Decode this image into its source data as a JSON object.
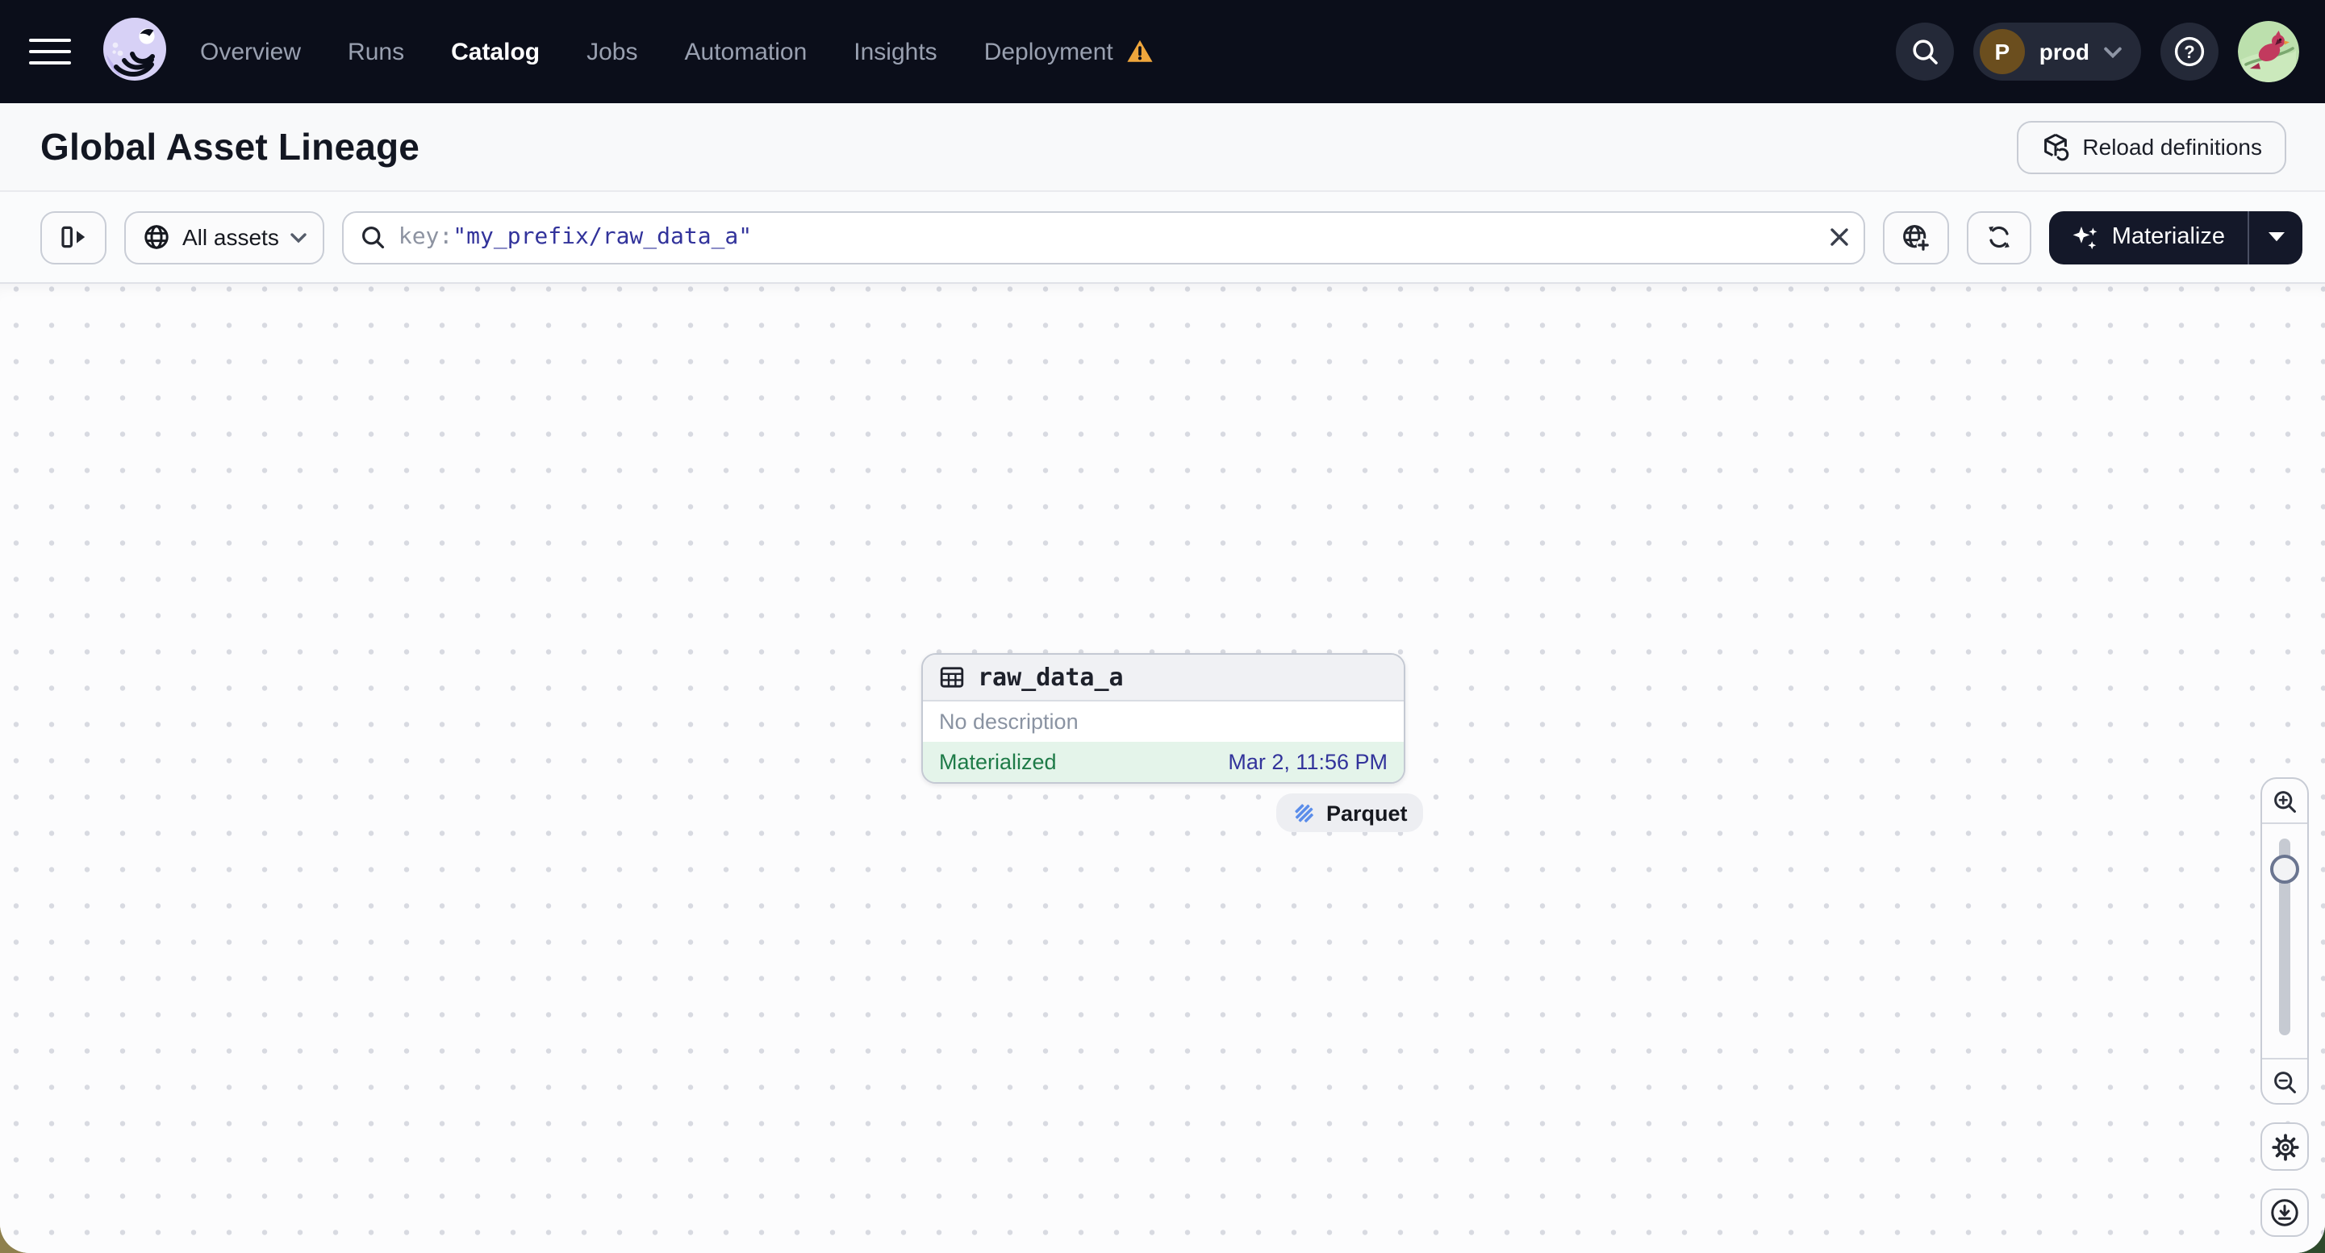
{
  "nav": {
    "items": [
      {
        "label": "Overview"
      },
      {
        "label": "Runs"
      },
      {
        "label": "Catalog"
      },
      {
        "label": "Jobs"
      },
      {
        "label": "Automation"
      },
      {
        "label": "Insights"
      },
      {
        "label": "Deployment"
      }
    ],
    "environment": {
      "initial": "P",
      "name": "prod"
    }
  },
  "header": {
    "title": "Global Asset Lineage",
    "reload_label": "Reload definitions"
  },
  "toolbar": {
    "scope_label": "All assets",
    "query_prefix": "key:",
    "query_value": "\"my_prefix/raw_data_a\"",
    "materialize_label": "Materialize"
  },
  "canvas": {
    "node": {
      "name": "raw_data_a",
      "description": "No description",
      "status": "Materialized",
      "materialized_at": "Mar 2, 11:56 PM"
    },
    "tag": {
      "label": "Parquet"
    }
  },
  "colors": {
    "navbar_bg": "#0B0E1A",
    "accent_dark_button": "#141829",
    "status_green": "#1E7B48",
    "timestamp_indigo": "#32339B",
    "query_indigo": "#32339B",
    "warning_amber": "#EFA63C",
    "node_footer_green": "#E4F4EA",
    "parquet_blue": "#5B8DEA"
  }
}
